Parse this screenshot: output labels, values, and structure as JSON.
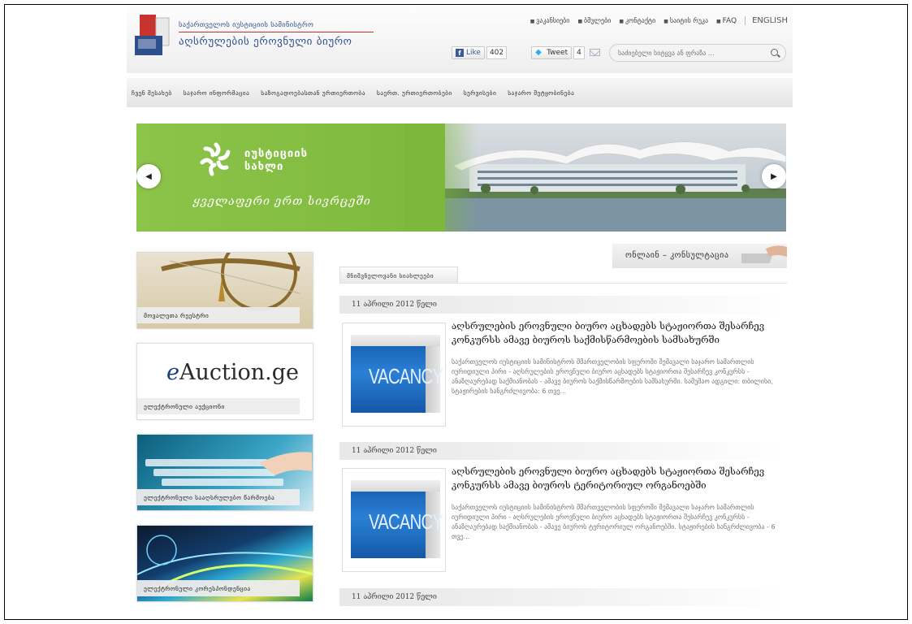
{
  "header": {
    "org_line1": "საქართველოს იუსტიციის სამინისტრო",
    "org_line2": "აღსრულების ეროვნული ბიურო",
    "top_links": [
      "ვაკანსიები",
      "ბმულები",
      "კონტაქტი",
      "საიტის რუკა",
      "FAQ"
    ],
    "language": "ENGLISH",
    "like_label": "Like",
    "like_count": "402",
    "tweet_label": "Tweet",
    "tweet_count": "4",
    "search_placeholder": "საძიებელი სიტყვა ან ფრაზა ..."
  },
  "nav": {
    "items": [
      "ჩვენ შესახებ",
      "საჯარო ინფორმაცია",
      "საზოგადოებასთან ურთიერთობა",
      "საერთ. ურთიერთობები",
      "სერვისები",
      "საჯარო შეტყობინება"
    ]
  },
  "banner": {
    "title_line1": "იუსტიციის",
    "title_line2": "სახლი",
    "slogan": "ყველაფერი ერთ სივრცეში"
  },
  "sidebar": {
    "boxes": [
      {
        "label": "მოვალეთა რეესტრი"
      },
      {
        "label": "ელექტრონული აუქციონი",
        "logo_e": "e",
        "logo_rest": "Auction.ge"
      },
      {
        "label": "ელექტრონული სააღსრულებო წარმოება"
      },
      {
        "label": "ელექტრონული კორესპონდენცია"
      }
    ]
  },
  "main": {
    "online_label": "ონლაინ – კონსულტაცია",
    "tab_label": "მნიშვნელოვანი სიახლეები",
    "posts": [
      {
        "date": "11 აპრილი 2012 წელი",
        "image_text": "VACANCY",
        "title": "აღსრულების ეროვნული ბიურო აცხადებს სტაჟიორთა შესარჩევ კონკურსს ამავე ბიუროს საქმისწარმოების სამსახურში",
        "text": "საქართველოს იუსტიციის სამინისტროს მმართველობის სფეროში შემავალი საჯარო სამართლის იურიდიული პირი - აღსრულების ეროვნული ბიურო აცხადებს სტაჟიორთა შესარჩევ კონკურსს - ანაზღაურებად საქმიანობას - ამავე ბიუროს საქმისწარმოების სამსახურში. სამუშაო ადგილი: თბილისი, სტაჟირების ხანგრძლივობა: 6 თვე..."
      },
      {
        "date": "11 აპრილი 2012 წელი",
        "image_text": "VACANCY",
        "title": "აღსრულების ეროვნული ბიურო აცხადებს სტაჟიორთა შესარჩევ კონკურსს ამავე ბიუროს ტერიტორიულ ორგანოებში",
        "text": "საქართველოს იუსტიციის სამინისტროს მმართველობის სფეროში შემავალი საჯარო სამართლის იურიდიული პირი - აღსრულების ეროვნული ბიურო აცხადებს სტაჟიორთა შესარჩევ კონკურსს - ანაზღაურებად საქმიანობას - ამავე ბიუროს ტერიტორიულ ორგანოებში. სტაჟირების ხანგრძლივობა - 6 თვე..."
      },
      {
        "date": "11 აპრილი 2012 წელი"
      }
    ]
  },
  "colors": {
    "brand_blue": "#2d4f8c",
    "brand_red": "#c8332f",
    "banner_green": "#8cc44a"
  }
}
